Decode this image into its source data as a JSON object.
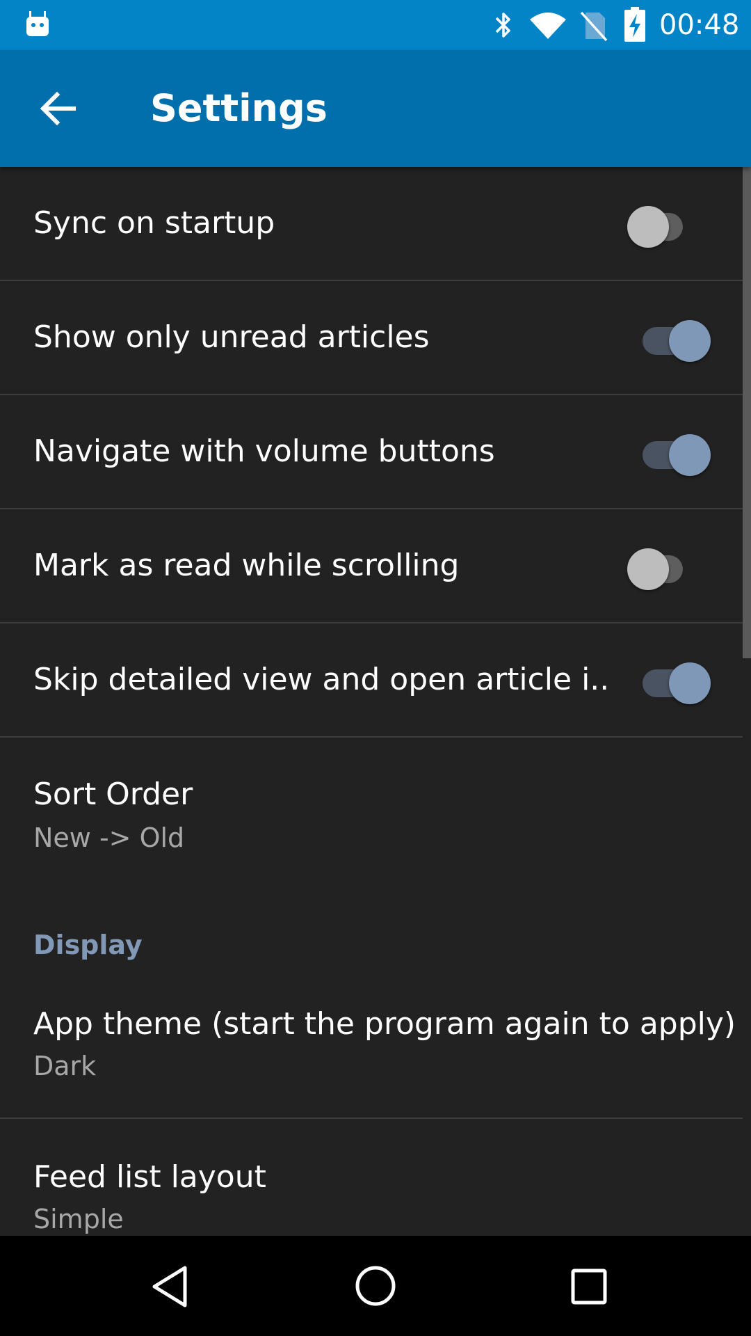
{
  "status_bar": {
    "time": "00:48",
    "icons": [
      "android-icon",
      "bluetooth-icon",
      "wifi-icon",
      "no-sim-icon",
      "battery-charging-icon"
    ]
  },
  "toolbar": {
    "title": "Settings",
    "back_icon": "arrow-back-icon"
  },
  "settings": [
    {
      "label": "Sync on startup",
      "switch": "off"
    },
    {
      "label": "Show only unread articles",
      "switch": "on"
    },
    {
      "label": "Navigate with volume buttons",
      "switch": "on"
    },
    {
      "label": "Mark as read while scrolling",
      "switch": "off"
    },
    {
      "label": "Skip detailed view and open article i..",
      "switch": "on"
    },
    {
      "label": "Sort Order",
      "summary": "New -> Old"
    }
  ],
  "display_category": {
    "title": "Display",
    "items": [
      {
        "label": "App theme (start the program again to apply)",
        "summary": "Dark"
      },
      {
        "label": "Feed list layout",
        "summary": "Simple"
      }
    ]
  },
  "nav_bar": {
    "icons": [
      "nav-back-icon",
      "nav-home-icon",
      "nav-recents-icon"
    ]
  },
  "colors": {
    "status_bar": "#0284C7",
    "toolbar": "#016FAB",
    "background": "#222222",
    "accent": "#8198B7"
  }
}
